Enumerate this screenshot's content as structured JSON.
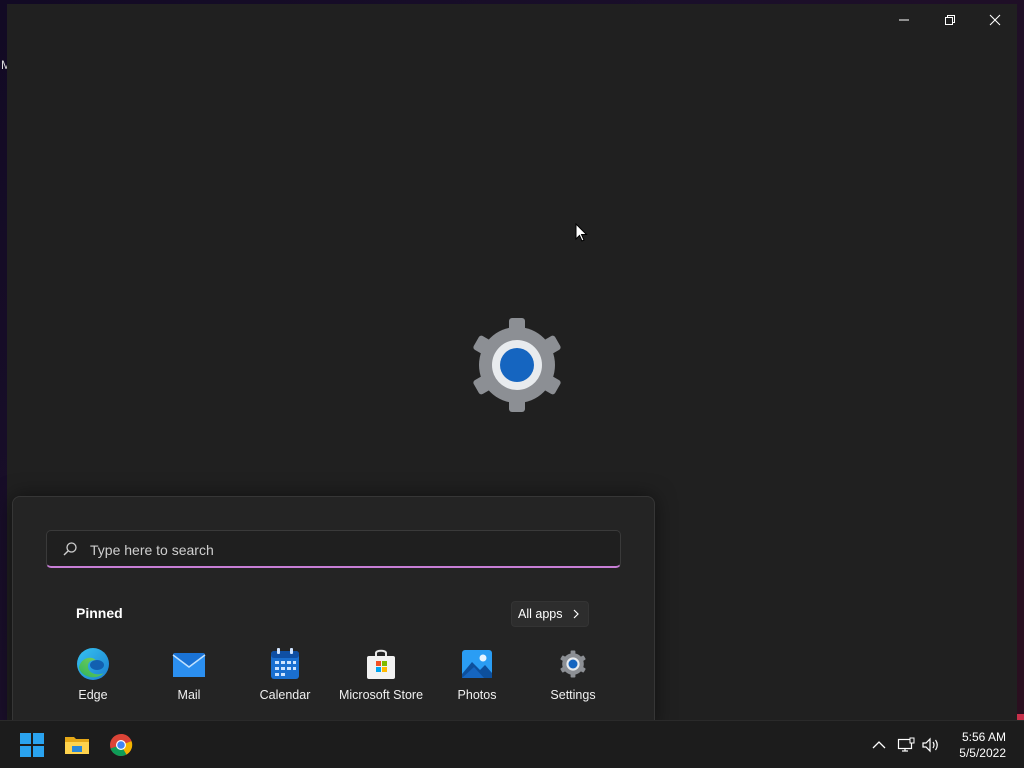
{
  "desktop": {
    "edge_text": "M"
  },
  "window": {
    "minimize_label": "Minimize",
    "restore_label": "Restore",
    "close_label": "Close",
    "splash_icon": "settings-gear-icon"
  },
  "start_menu": {
    "search_placeholder": "Type here to search",
    "pinned_label": "Pinned",
    "all_apps_label": "All apps",
    "pinned_apps": [
      {
        "label": "Edge",
        "icon": "edge-icon"
      },
      {
        "label": "Mail",
        "icon": "mail-icon"
      },
      {
        "label": "Calendar",
        "icon": "calendar-icon"
      },
      {
        "label": "Microsoft Store",
        "icon": "store-icon"
      },
      {
        "label": "Photos",
        "icon": "photos-icon"
      },
      {
        "label": "Settings",
        "icon": "settings-icon"
      }
    ]
  },
  "taskbar": {
    "items": [
      "start-icon",
      "file-explorer-icon",
      "chrome-icon"
    ],
    "tray": [
      "chevron-up-icon",
      "network-icon",
      "volume-icon"
    ],
    "time": "5:56 AM",
    "date": "5/5/2022"
  },
  "colors": {
    "accent": "#c77ed6",
    "window_bg": "#202020",
    "taskbar_bg": "#1c1c1c"
  }
}
